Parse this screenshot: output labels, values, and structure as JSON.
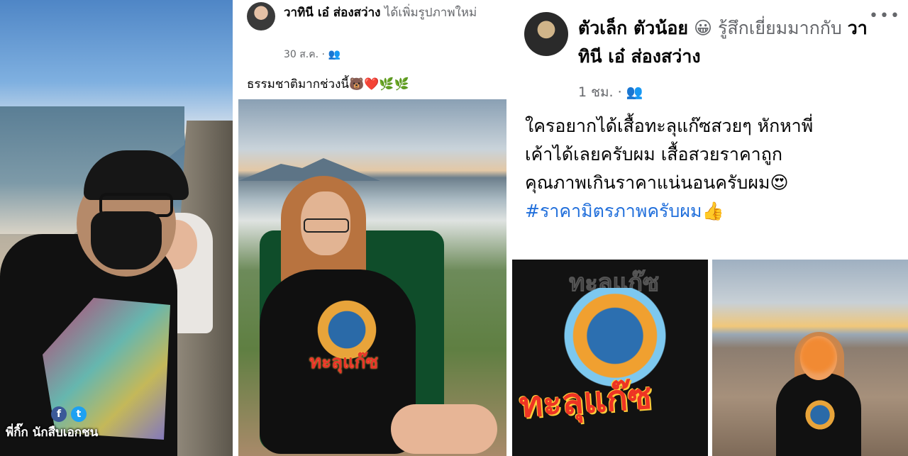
{
  "panel1": {
    "watermark": "พี่กิ๊ก นักสืบเอกชน",
    "social_icons": [
      "facebook-icon",
      "twitter-icon"
    ]
  },
  "post1": {
    "author": "วาทินี เอ๋ ส่องสว่าง",
    "action": " ได้เพิ่มรูปภาพใหม่",
    "timestamp": "30 ส.ค.",
    "audience_icon": "friends-icon",
    "text": "ธรรมชาติมากช่วงนี้🐻❤️🌿🌿",
    "shirt_logo": "ทะลุแก๊ซ"
  },
  "post2": {
    "author": "ตัวเล็ก ตัวน้อย",
    "feeling_emoji": "😀",
    "feeling": " รู้สึกเยี่ยมมากกับ ",
    "tagged": "วาทินี เอ๋ ส่องสว่าง",
    "timestamp": "1 ชม.",
    "audience_icon": "friends-icon",
    "more": "•••",
    "text_line1": "ใครอยากได้เสื้อทะลุแก๊ซสวยๆ หักหาพี่",
    "text_line2": "เค้าได้เลยครับผม เสื้อสวยราคาถูก",
    "text_line3": "คุณภาพเกินราคาแน่นอนครับผม😍",
    "hashtag": "#ราคามิตรภาพครับผม",
    "hashtag_emoji": "👍",
    "shirt_logo": "ทะลุแก๊ซ",
    "shirt_bg_text": "ทะลุแก๊ซ"
  },
  "colors": {
    "link": "#216fdb",
    "meta": "#65676b",
    "logo_red": "#ee3424"
  }
}
